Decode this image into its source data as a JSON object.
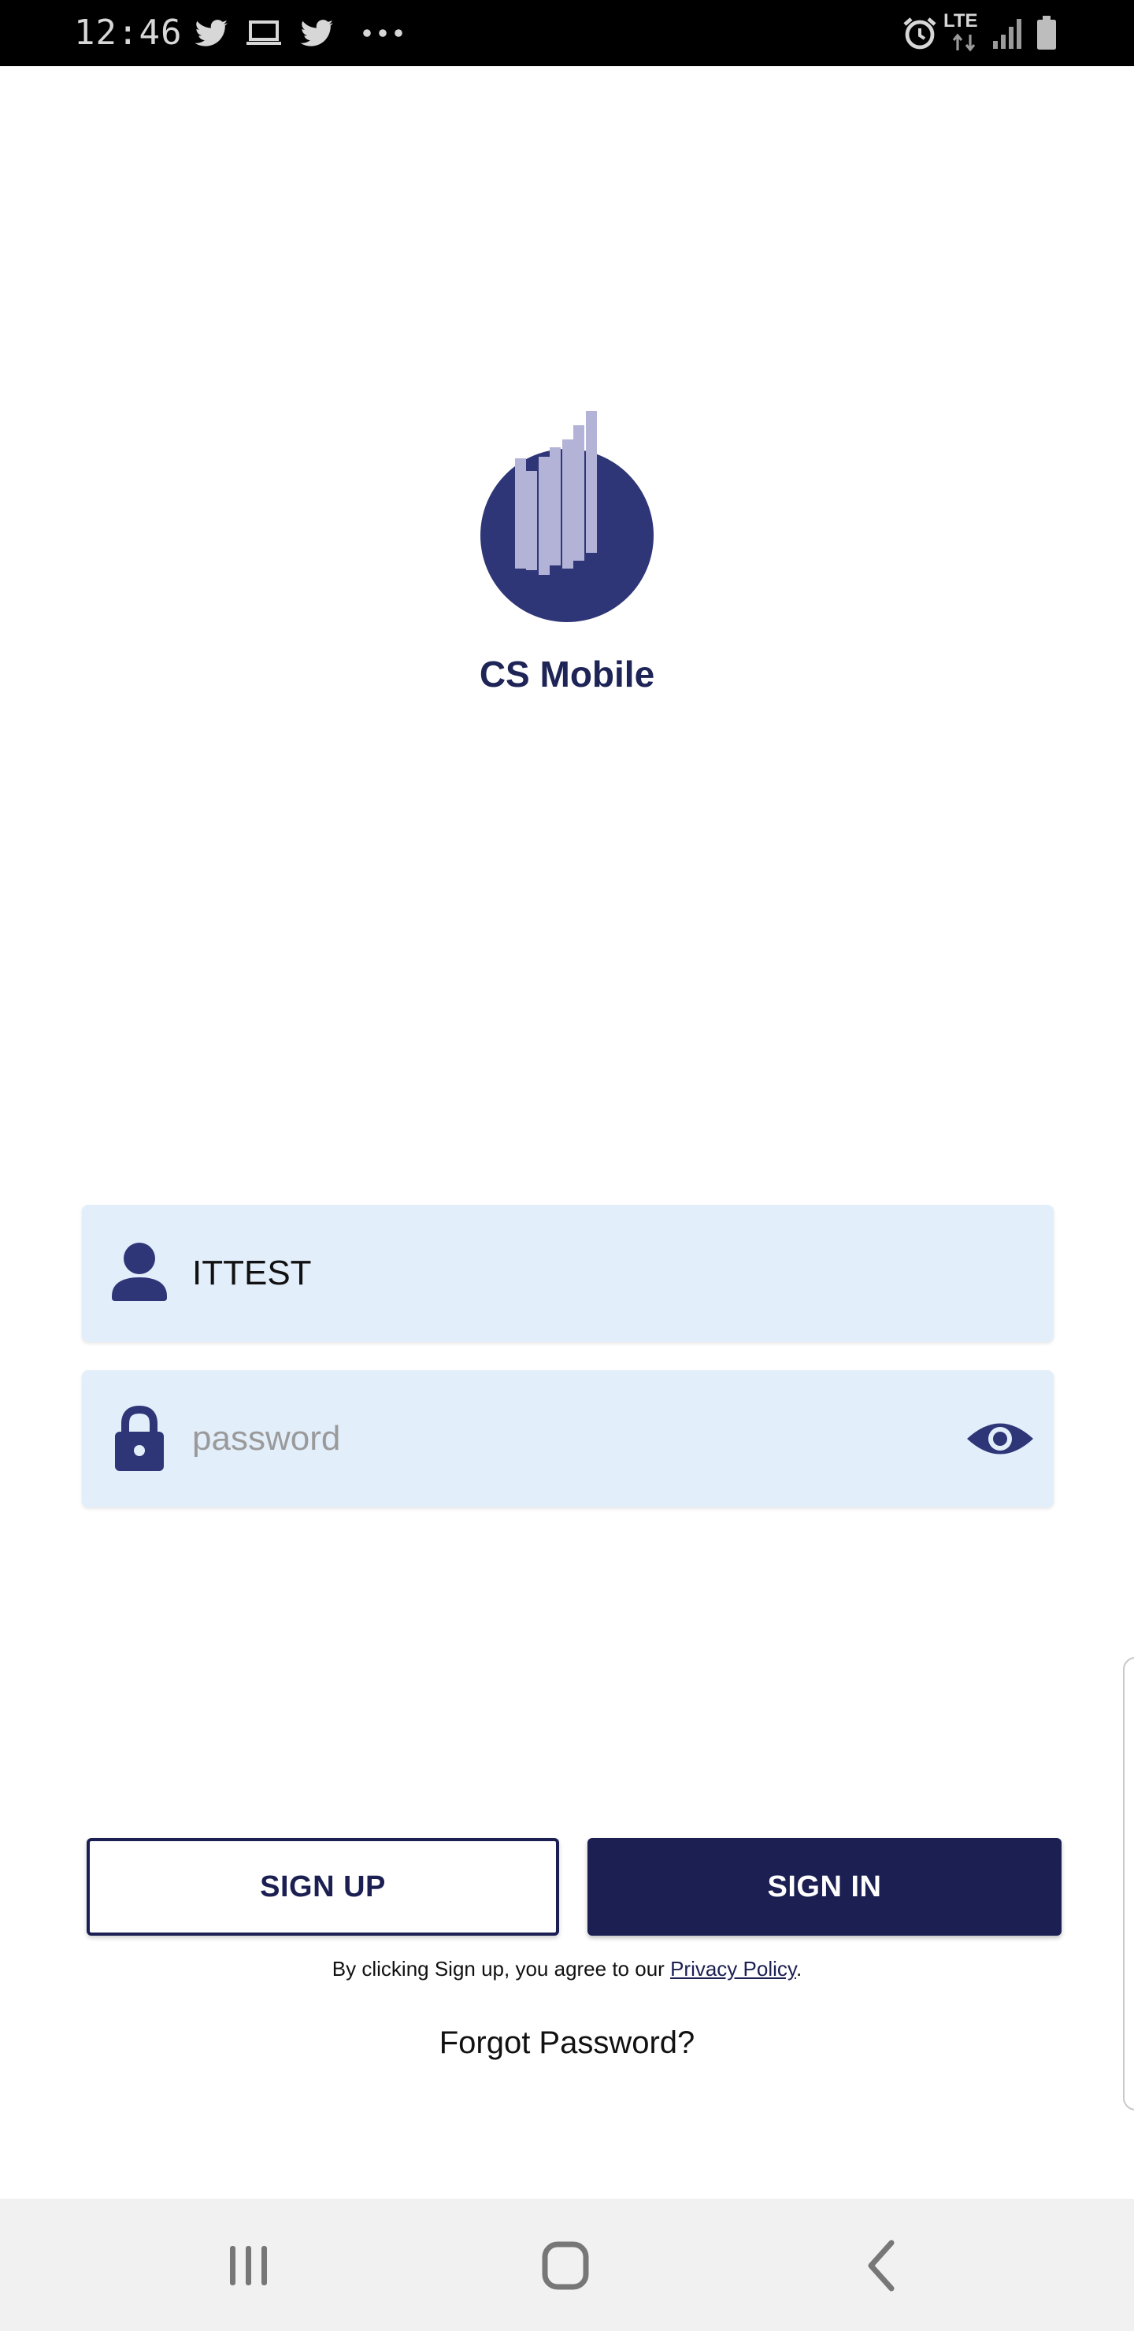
{
  "status_bar": {
    "time": "12:46",
    "icons": [
      "twitter-icon",
      "laptop-icon",
      "twitter-icon",
      "more-icon",
      "alarm-icon",
      "lte-icon",
      "signal-icon",
      "battery-icon"
    ],
    "network_label": "LTE"
  },
  "app": {
    "name": "CS Mobile",
    "brand_color": "#2f3677",
    "accent_bar_color": "#b3b3d8"
  },
  "login": {
    "username": {
      "value": "ITTEST",
      "icon": "user-icon"
    },
    "password": {
      "value": "",
      "placeholder": "password",
      "icon": "lock-icon",
      "toggle_icon": "eye-icon"
    },
    "sign_up_label": "SIGN UP",
    "sign_in_label": "SIGN IN",
    "agree_prefix": "By clicking Sign up, you agree to our",
    "privacy_link": "Privacy Policy",
    "agree_suffix": ".",
    "forgot_password": "Forgot Password?"
  },
  "nav_bar": {
    "buttons": [
      "recents-icon",
      "home-icon",
      "back-icon"
    ]
  },
  "colors": {
    "primary": "#1b1f52",
    "field_background": "#e3eefb",
    "nav_background": "#f1f1f1"
  }
}
